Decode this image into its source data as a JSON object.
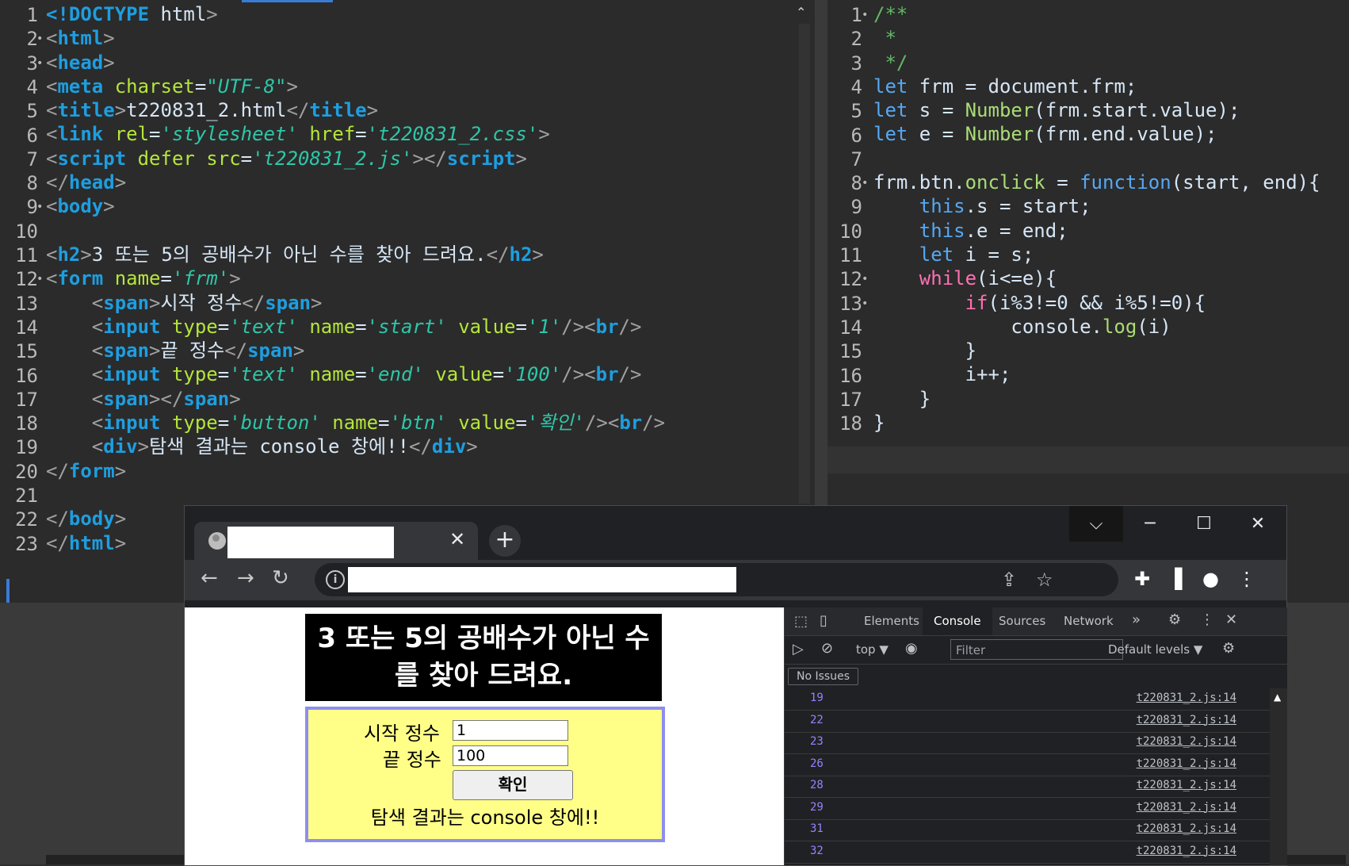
{
  "left_editor": {
    "line_numbers": [
      "1",
      "2",
      "3",
      "4",
      "5",
      "6",
      "7",
      "8",
      "9",
      "10",
      "11",
      "12",
      "13",
      "14",
      "15",
      "16",
      "17",
      "18",
      "19",
      "20",
      "21",
      "22",
      "23"
    ],
    "lines": [
      [
        {
          "c": "t",
          "x": "<!DOCTYPE"
        },
        {
          "c": "v",
          "x": " html"
        },
        {
          "c": "p",
          "x": ">"
        }
      ],
      [
        {
          "c": "p",
          "x": "<"
        },
        {
          "c": "t",
          "x": "html"
        },
        {
          "c": "p",
          "x": ">"
        }
      ],
      [
        {
          "c": "p",
          "x": "<"
        },
        {
          "c": "t",
          "x": "head"
        },
        {
          "c": "p",
          "x": ">"
        }
      ],
      [
        {
          "c": "p",
          "x": "<"
        },
        {
          "c": "t",
          "x": "meta"
        },
        {
          "c": "a",
          "x": " charset"
        },
        {
          "c": "v",
          "x": "="
        },
        {
          "c": "s",
          "x": "\"UTF-8\""
        },
        {
          "c": "p",
          "x": ">"
        }
      ],
      [
        {
          "c": "p",
          "x": "<"
        },
        {
          "c": "t",
          "x": "title"
        },
        {
          "c": "p",
          "x": ">"
        },
        {
          "c": "v",
          "x": "t220831_2.html"
        },
        {
          "c": "p",
          "x": "</"
        },
        {
          "c": "t",
          "x": "title"
        },
        {
          "c": "p",
          "x": ">"
        }
      ],
      [
        {
          "c": "p",
          "x": "<"
        },
        {
          "c": "t",
          "x": "link"
        },
        {
          "c": "a",
          "x": " rel"
        },
        {
          "c": "v",
          "x": "="
        },
        {
          "c": "s",
          "x": "'stylesheet'"
        },
        {
          "c": "a",
          "x": " href"
        },
        {
          "c": "v",
          "x": "="
        },
        {
          "c": "s",
          "x": "'t220831_2.css'"
        },
        {
          "c": "p",
          "x": ">"
        }
      ],
      [
        {
          "c": "p",
          "x": "<"
        },
        {
          "c": "t",
          "x": "script"
        },
        {
          "c": "a",
          "x": " defer src"
        },
        {
          "c": "v",
          "x": "="
        },
        {
          "c": "s",
          "x": "'t220831_2.js'"
        },
        {
          "c": "p",
          "x": "></"
        },
        {
          "c": "t",
          "x": "script"
        },
        {
          "c": "p",
          "x": ">"
        }
      ],
      [
        {
          "c": "p",
          "x": "</"
        },
        {
          "c": "t",
          "x": "head"
        },
        {
          "c": "p",
          "x": ">"
        }
      ],
      [
        {
          "c": "p",
          "x": "<"
        },
        {
          "c": "t",
          "x": "body"
        },
        {
          "c": "p",
          "x": ">"
        }
      ],
      [],
      [
        {
          "c": "p",
          "x": "<"
        },
        {
          "c": "t",
          "x": "h2"
        },
        {
          "c": "p",
          "x": ">"
        },
        {
          "c": "v",
          "x": "3 또는 5의 공배수가 아닌 수를 찾아 드려요."
        },
        {
          "c": "p",
          "x": "</"
        },
        {
          "c": "t",
          "x": "h2"
        },
        {
          "c": "p",
          "x": ">"
        }
      ],
      [
        {
          "c": "p",
          "x": "<"
        },
        {
          "c": "t",
          "x": "form"
        },
        {
          "c": "a",
          "x": " name"
        },
        {
          "c": "v",
          "x": "="
        },
        {
          "c": "s",
          "x": "'frm'"
        },
        {
          "c": "p",
          "x": ">"
        }
      ],
      [
        {
          "c": "v",
          "x": "    "
        },
        {
          "c": "p",
          "x": "<"
        },
        {
          "c": "t",
          "x": "span"
        },
        {
          "c": "p",
          "x": ">"
        },
        {
          "c": "v",
          "x": "시작 정수"
        },
        {
          "c": "p",
          "x": "</"
        },
        {
          "c": "t",
          "x": "span"
        },
        {
          "c": "p",
          "x": ">"
        }
      ],
      [
        {
          "c": "v",
          "x": "    "
        },
        {
          "c": "p",
          "x": "<"
        },
        {
          "c": "t",
          "x": "input"
        },
        {
          "c": "a",
          "x": " type"
        },
        {
          "c": "v",
          "x": "="
        },
        {
          "c": "s",
          "x": "'text'"
        },
        {
          "c": "a",
          "x": " name"
        },
        {
          "c": "v",
          "x": "="
        },
        {
          "c": "s",
          "x": "'start'"
        },
        {
          "c": "a",
          "x": " value"
        },
        {
          "c": "v",
          "x": "="
        },
        {
          "c": "s",
          "x": "'1'"
        },
        {
          "c": "p",
          "x": "/><"
        },
        {
          "c": "t",
          "x": "br"
        },
        {
          "c": "p",
          "x": "/>"
        }
      ],
      [
        {
          "c": "v",
          "x": "    "
        },
        {
          "c": "p",
          "x": "<"
        },
        {
          "c": "t",
          "x": "span"
        },
        {
          "c": "p",
          "x": ">"
        },
        {
          "c": "v",
          "x": "끝 정수"
        },
        {
          "c": "p",
          "x": "</"
        },
        {
          "c": "t",
          "x": "span"
        },
        {
          "c": "p",
          "x": ">"
        }
      ],
      [
        {
          "c": "v",
          "x": "    "
        },
        {
          "c": "p",
          "x": "<"
        },
        {
          "c": "t",
          "x": "input"
        },
        {
          "c": "a",
          "x": " type"
        },
        {
          "c": "v",
          "x": "="
        },
        {
          "c": "s",
          "x": "'text'"
        },
        {
          "c": "a",
          "x": " name"
        },
        {
          "c": "v",
          "x": "="
        },
        {
          "c": "s",
          "x": "'end'"
        },
        {
          "c": "a",
          "x": " value"
        },
        {
          "c": "v",
          "x": "="
        },
        {
          "c": "s",
          "x": "'100'"
        },
        {
          "c": "p",
          "x": "/><"
        },
        {
          "c": "t",
          "x": "br"
        },
        {
          "c": "p",
          "x": "/>"
        }
      ],
      [
        {
          "c": "v",
          "x": "    "
        },
        {
          "c": "p",
          "x": "<"
        },
        {
          "c": "t",
          "x": "span"
        },
        {
          "c": "p",
          "x": "></"
        },
        {
          "c": "t",
          "x": "span"
        },
        {
          "c": "p",
          "x": ">"
        }
      ],
      [
        {
          "c": "v",
          "x": "    "
        },
        {
          "c": "p",
          "x": "<"
        },
        {
          "c": "t",
          "x": "input"
        },
        {
          "c": "a",
          "x": " type"
        },
        {
          "c": "v",
          "x": "="
        },
        {
          "c": "s",
          "x": "'button'"
        },
        {
          "c": "a",
          "x": " name"
        },
        {
          "c": "v",
          "x": "="
        },
        {
          "c": "s",
          "x": "'btn'"
        },
        {
          "c": "a",
          "x": " value"
        },
        {
          "c": "v",
          "x": "="
        },
        {
          "c": "s",
          "x": "'확인'"
        },
        {
          "c": "p",
          "x": "/><"
        },
        {
          "c": "t",
          "x": "br"
        },
        {
          "c": "p",
          "x": "/>"
        }
      ],
      [
        {
          "c": "v",
          "x": "    "
        },
        {
          "c": "p",
          "x": "<"
        },
        {
          "c": "t",
          "x": "div"
        },
        {
          "c": "p",
          "x": ">"
        },
        {
          "c": "v",
          "x": "탐색 결과는 console 창에!!"
        },
        {
          "c": "p",
          "x": "</"
        },
        {
          "c": "t",
          "x": "div"
        },
        {
          "c": "p",
          "x": ">"
        }
      ],
      [
        {
          "c": "p",
          "x": "</"
        },
        {
          "c": "t",
          "x": "form"
        },
        {
          "c": "p",
          "x": ">"
        }
      ],
      [],
      [
        {
          "c": "p",
          "x": "</"
        },
        {
          "c": "t",
          "x": "body"
        },
        {
          "c": "p",
          "x": ">"
        }
      ],
      [
        {
          "c": "p",
          "x": "</"
        },
        {
          "c": "t",
          "x": "html"
        },
        {
          "c": "p",
          "x": ">"
        }
      ]
    ]
  },
  "right_editor": {
    "line_numbers": [
      "1",
      "2",
      "3",
      "4",
      "5",
      "6",
      "7",
      "8",
      "9",
      "10",
      "11",
      "12",
      "13",
      "14",
      "15",
      "16",
      "17",
      "18"
    ],
    "lines": [
      [
        {
          "c": "cm",
          "x": "/**"
        }
      ],
      [
        {
          "c": "cm",
          "x": " *"
        }
      ],
      [
        {
          "c": "cm",
          "x": " */"
        }
      ],
      [
        {
          "c": "k",
          "x": "let"
        },
        {
          "c": "v",
          "x": " frm = document.frm;"
        }
      ],
      [
        {
          "c": "k",
          "x": "let"
        },
        {
          "c": "v",
          "x": " s = "
        },
        {
          "c": "fn",
          "x": "Number"
        },
        {
          "c": "v",
          "x": "(frm.start.value);"
        }
      ],
      [
        {
          "c": "k",
          "x": "let"
        },
        {
          "c": "v",
          "x": " e = "
        },
        {
          "c": "fn",
          "x": "Number"
        },
        {
          "c": "v",
          "x": "(frm.end.value);"
        }
      ],
      [],
      [
        {
          "c": "v",
          "x": "frm.btn."
        },
        {
          "c": "fn",
          "x": "onclick"
        },
        {
          "c": "v",
          "x": " = "
        },
        {
          "c": "k",
          "x": "function"
        },
        {
          "c": "v",
          "x": "(start, end){"
        }
      ],
      [
        {
          "c": "v",
          "x": "    "
        },
        {
          "c": "k",
          "x": "this"
        },
        {
          "c": "v",
          "x": ".s = start;"
        }
      ],
      [
        {
          "c": "v",
          "x": "    "
        },
        {
          "c": "k",
          "x": "this"
        },
        {
          "c": "v",
          "x": ".e = end;"
        }
      ],
      [
        {
          "c": "v",
          "x": "    "
        },
        {
          "c": "k",
          "x": "let"
        },
        {
          "c": "v",
          "x": " i = s;"
        }
      ],
      [
        {
          "c": "v",
          "x": "    "
        },
        {
          "c": "kw",
          "x": "while"
        },
        {
          "c": "v",
          "x": "(i<=e){"
        }
      ],
      [
        {
          "c": "v",
          "x": "        "
        },
        {
          "c": "kw",
          "x": "if"
        },
        {
          "c": "v",
          "x": "(i%3!=0 && i%5!=0){"
        }
      ],
      [
        {
          "c": "v",
          "x": "            console."
        },
        {
          "c": "fn",
          "x": "log"
        },
        {
          "c": "v",
          "x": "(i)"
        }
      ],
      [
        {
          "c": "v",
          "x": "        }"
        }
      ],
      [
        {
          "c": "v",
          "x": "        i++;"
        }
      ],
      [
        {
          "c": "v",
          "x": "    }"
        }
      ],
      [
        {
          "c": "v",
          "x": "}"
        }
      ]
    ]
  },
  "browser": {
    "tab_close": "✕",
    "new_tab": "+",
    "window_controls": {
      "dropdown": "⌵",
      "minimize": "─",
      "maximize": "☐",
      "close": "✕"
    },
    "nav": {
      "back": "←",
      "forward": "→",
      "reload": "↻"
    },
    "page": {
      "h2": "3 또는 5의 공배수가 아닌 수를 찾아 드려요.",
      "start_label": "시작 정수",
      "start_value": "1",
      "end_label": "끝 정수",
      "end_value": "100",
      "button_label": "확인",
      "result_text": "탐색 결과는 console 창에!!"
    }
  },
  "devtools": {
    "tabs": [
      "Elements",
      "Console",
      "Sources",
      "Network"
    ],
    "more_tabs": "»",
    "top_context": "top ▼",
    "filter_placeholder": "Filter",
    "levels": "Default levels ▼",
    "issues": "No Issues",
    "console_rows": [
      {
        "value": "19",
        "source": "t220831_2.js:14"
      },
      {
        "value": "22",
        "source": "t220831_2.js:14"
      },
      {
        "value": "23",
        "source": "t220831_2.js:14"
      },
      {
        "value": "26",
        "source": "t220831_2.js:14"
      },
      {
        "value": "28",
        "source": "t220831_2.js:14"
      },
      {
        "value": "29",
        "source": "t220831_2.js:14"
      },
      {
        "value": "31",
        "source": "t220831_2.js:14"
      },
      {
        "value": "32",
        "source": "t220831_2.js:14"
      }
    ]
  }
}
